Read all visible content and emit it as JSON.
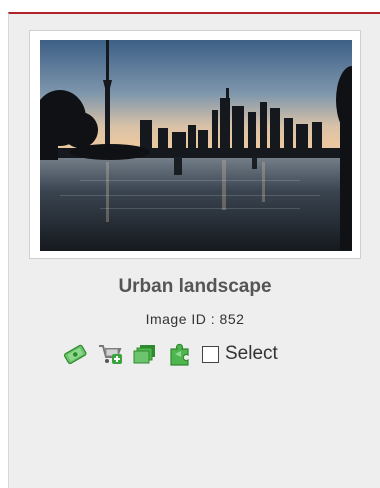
{
  "card": {
    "title": "Urban landscape",
    "image_id_label": "Image ID : 852",
    "select_label": "Select",
    "select_checked": false
  },
  "actions": [
    {
      "name": "buy-icon"
    },
    {
      "name": "add-to-cart-icon"
    },
    {
      "name": "lightbox-icon"
    },
    {
      "name": "similar-images-icon"
    }
  ],
  "colors": {
    "accent": "#b2222b",
    "card_bg": "#eeeeee",
    "icon_green": "#3aa43a"
  }
}
